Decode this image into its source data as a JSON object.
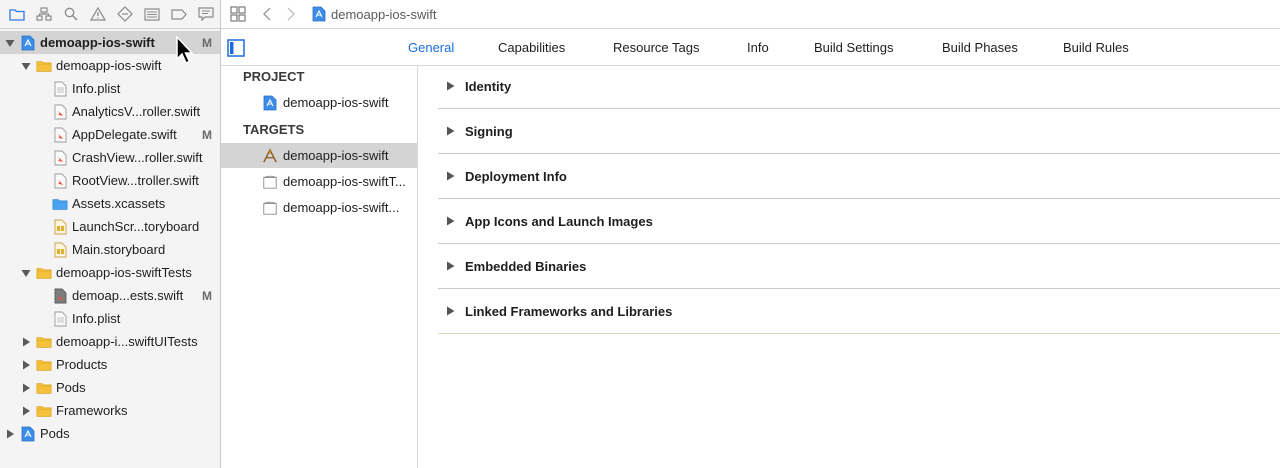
{
  "navigator": {
    "toolbar_icons": [
      "folder-icon",
      "hierarchy-icon",
      "search-icon",
      "warning-icon",
      "test-diamond-icon",
      "debug-list-icon",
      "breakpoint-icon",
      "report-icon"
    ],
    "tree": [
      {
        "label": "demoapp-ios-swift",
        "icon": "project-icon",
        "expanded": true,
        "depth": 0,
        "badge": "M",
        "selected": true,
        "bold": true
      },
      {
        "label": "demoapp-ios-swift",
        "icon": "folder-icon",
        "expanded": true,
        "depth": 1
      },
      {
        "label": "Info.plist",
        "icon": "plist-icon",
        "depth": 2
      },
      {
        "label": "AnalyticsV...roller.swift",
        "icon": "swift-file-icon",
        "depth": 2
      },
      {
        "label": "AppDelegate.swift",
        "icon": "swift-file-icon",
        "depth": 2,
        "badge": "M"
      },
      {
        "label": "CrashView...roller.swift",
        "icon": "swift-file-icon",
        "depth": 2
      },
      {
        "label": "RootView...troller.swift",
        "icon": "swift-file-icon",
        "depth": 2
      },
      {
        "label": "Assets.xcassets",
        "icon": "assets-folder-icon",
        "depth": 2
      },
      {
        "label": "LaunchScr...toryboard",
        "icon": "storyboard-icon",
        "depth": 2
      },
      {
        "label": "Main.storyboard",
        "icon": "storyboard-icon",
        "depth": 2
      },
      {
        "label": "demoapp-ios-swiftTests",
        "icon": "folder-icon",
        "expanded": true,
        "depth": 1
      },
      {
        "label": "demoap...ests.swift",
        "icon": "swift-file-dark-icon",
        "depth": 2,
        "badge": "M"
      },
      {
        "label": "Info.plist",
        "icon": "plist-icon",
        "depth": 2
      },
      {
        "label": "demoapp-i...swiftUITests",
        "icon": "folder-icon",
        "expanded": false,
        "depth": 1
      },
      {
        "label": "Products",
        "icon": "folder-icon",
        "expanded": false,
        "depth": 1
      },
      {
        "label": "Pods",
        "icon": "folder-icon",
        "expanded": false,
        "depth": 1
      },
      {
        "label": "Frameworks",
        "icon": "folder-icon",
        "expanded": false,
        "depth": 1
      },
      {
        "label": "Pods",
        "icon": "project-icon",
        "expanded": false,
        "depth": 0
      }
    ]
  },
  "jumpbar": {
    "crumb": "demoapp-ios-swift"
  },
  "tabs": [
    "General",
    "Capabilities",
    "Resource Tags",
    "Info",
    "Build Settings",
    "Build Phases",
    "Build Rules"
  ],
  "active_tab": "General",
  "targets_panel": {
    "project_header": "PROJECT",
    "project_item": "demoapp-ios-swift",
    "targets_header": "TARGETS",
    "targets": [
      {
        "label": "demoapp-ios-swift",
        "icon": "app-target-icon",
        "selected": true
      },
      {
        "label": "demoapp-ios-swiftT...",
        "icon": "test-bundle-icon"
      },
      {
        "label": "demoapp-ios-swift...",
        "icon": "test-bundle-icon"
      }
    ]
  },
  "sections": [
    "Identity",
    "Signing",
    "Deployment Info",
    "App Icons and Launch Images",
    "Embedded Binaries",
    "Linked Frameworks and Libraries"
  ],
  "colors": {
    "accent": "#1a6de0",
    "folder": "#f5c13b",
    "selection": "#d4d4d4"
  }
}
